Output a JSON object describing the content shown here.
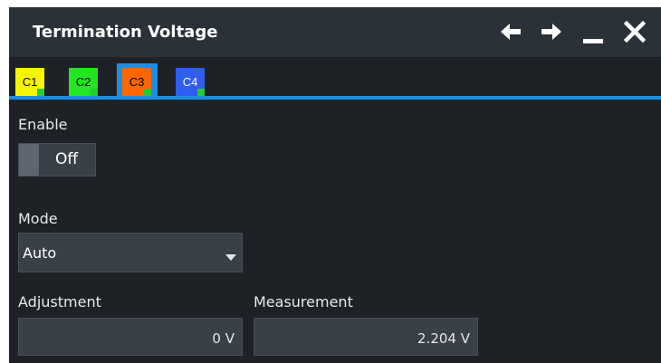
{
  "dialog": {
    "title": "Termination Voltage",
    "icons": {
      "back": "arrow-left-icon",
      "forward": "arrow-right-icon",
      "minimize": "minimize-icon",
      "close": "close-icon"
    }
  },
  "tabs": [
    {
      "label": "C1",
      "color": "#f5f500",
      "text_color": "#000000",
      "selected": false
    },
    {
      "label": "C2",
      "color": "#22e622",
      "text_color": "#000000",
      "selected": false
    },
    {
      "label": "C3",
      "color": "#ff6600",
      "text_color": "#000000",
      "selected": true
    },
    {
      "label": "C4",
      "color": "#2f5df0",
      "text_color": "#ffffff",
      "selected": false
    }
  ],
  "enable": {
    "label": "Enable",
    "state": "Off"
  },
  "mode": {
    "label": "Mode",
    "value": "Auto"
  },
  "adjustment": {
    "label": "Adjustment",
    "value": "0 V"
  },
  "measurement": {
    "label": "Measurement",
    "value": "2.204 V"
  },
  "colors": {
    "accent": "#1f8ee0",
    "background": "#1e2227",
    "titlebar": "#2b3138",
    "tab_indicator": "#22cc33"
  }
}
